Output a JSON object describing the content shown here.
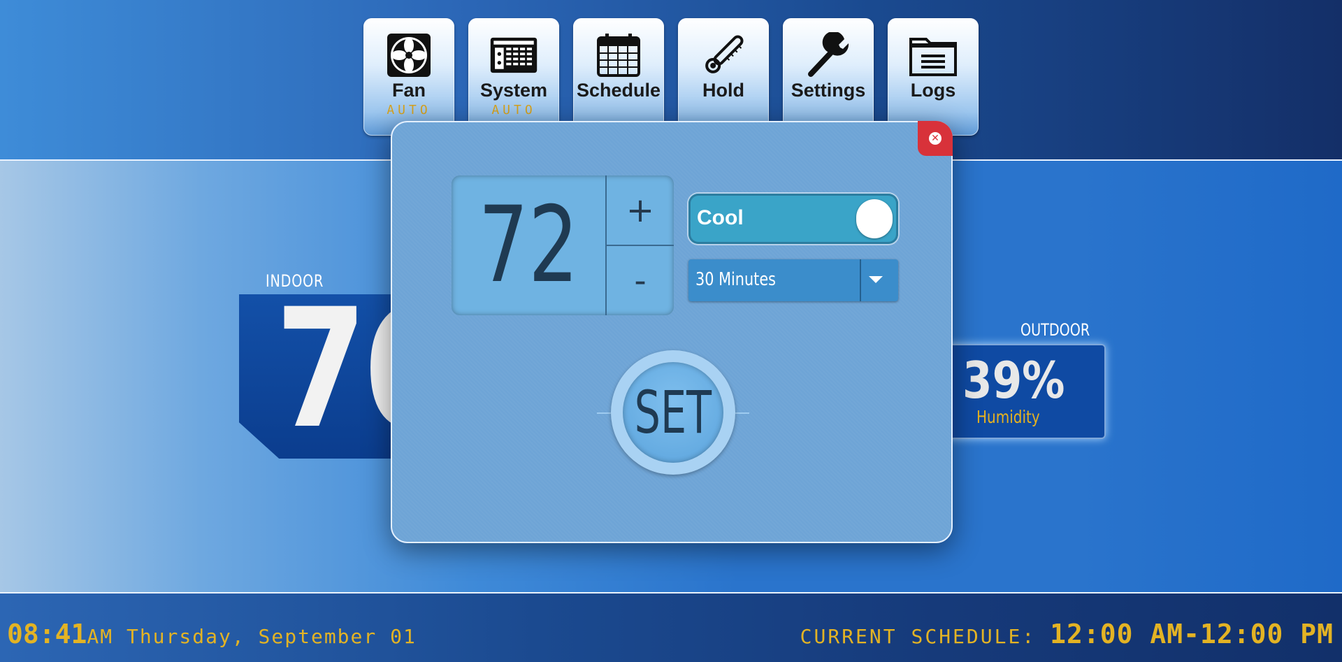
{
  "nav": {
    "items": [
      {
        "label": "Fan",
        "sub": "AUTO",
        "icon": "fan-icon"
      },
      {
        "label": "System",
        "sub": "AUTO",
        "icon": "hvac-unit-icon"
      },
      {
        "label": "Schedule",
        "sub": "",
        "icon": "calendar-icon"
      },
      {
        "label": "Hold",
        "sub": "",
        "icon": "thermometer-icon"
      },
      {
        "label": "Settings",
        "sub": "",
        "icon": "wrench-icon"
      },
      {
        "label": "Logs",
        "sub": "",
        "icon": "folder-icon"
      }
    ]
  },
  "indoor": {
    "label": "INDOOR",
    "temp": "76"
  },
  "outdoor": {
    "label": "OUTDOOR",
    "humidity": "39%",
    "humidity_label": "Humidity"
  },
  "hold_dialog": {
    "setpoint": "72",
    "plus": "+",
    "minus": "-",
    "mode": "Cool",
    "mode_on": true,
    "duration": "30 Minutes",
    "set_label": "SET",
    "close_icon": "close-icon"
  },
  "footer": {
    "time": "08:41",
    "time_rest": "AM Thursday, September 01",
    "schedule_label": "CURRENT SCHEDULE: ",
    "schedule_value": "12:00 AM-12:00 PM"
  },
  "colors": {
    "accent_gold": "#e3b324",
    "close_red": "#d8323a",
    "toggle_teal": "#3aa4c8"
  }
}
